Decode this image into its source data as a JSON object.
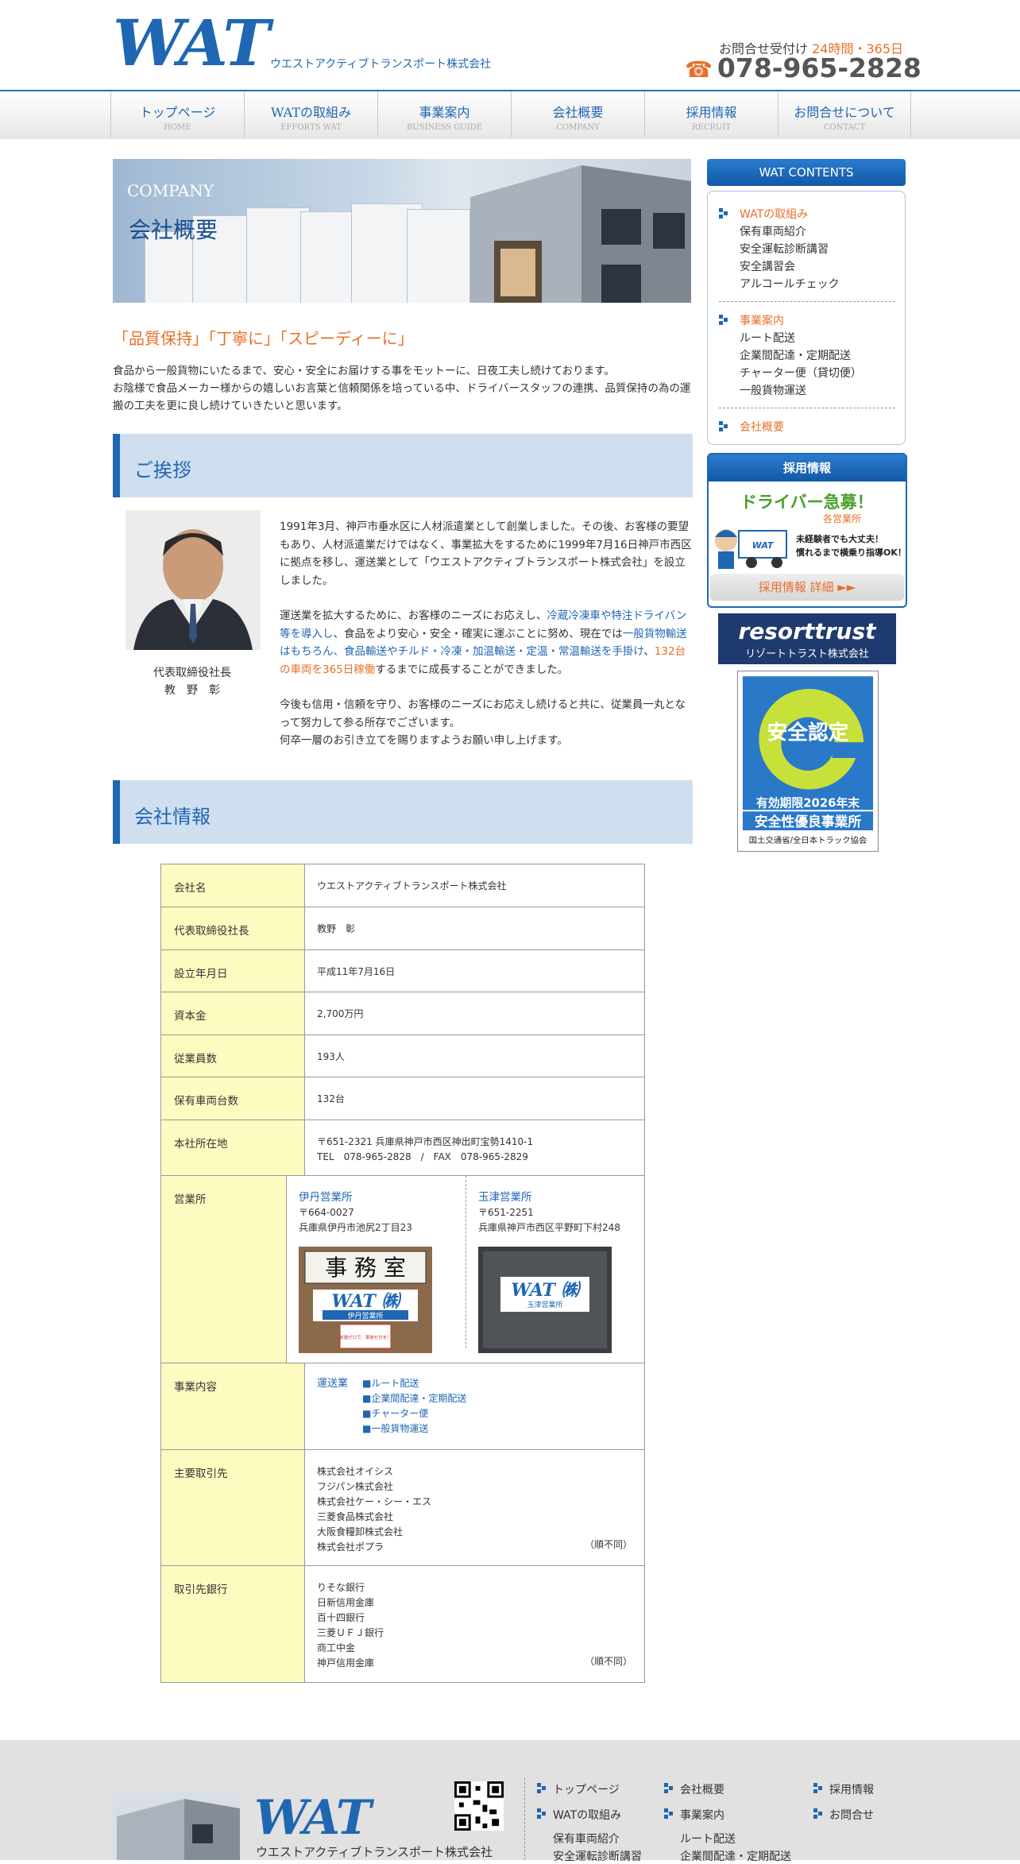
{
  "header": {
    "logo": "WAT",
    "company_name": "ウエストアクティブトランスポート株式会社",
    "contact_label": "お問合せ受付け",
    "contact_hours": "24時間・365日",
    "phone": "078-965-2828"
  },
  "nav": [
    {
      "label": "トップページ",
      "sub": "HOME"
    },
    {
      "label": "WATの取組み",
      "sub": "EFFORTS WAT"
    },
    {
      "label": "事業案内",
      "sub": "BUSINESS GUIDE"
    },
    {
      "label": "会社概要",
      "sub": "COMPANY"
    },
    {
      "label": "採用情報",
      "sub": "RECRUIT"
    },
    {
      "label": "お問合せについて",
      "sub": "CONTACT"
    }
  ],
  "hero": {
    "en": "COMPANY",
    "jp": "会社概要"
  },
  "catch": "「品質保持」「丁寧に」「スピーディーに」",
  "intro": {
    "line1": "食品から一般貨物にいたるまで、安心・安全にお届けする事をモットーに、日夜工夫し続けております。",
    "line2": "お陰様で食品メーカー様からの嬉しいお言葉と信頼関係を培っている中、ドライバースタッフの連携、品質保持の為の運搬の工夫を更に良し続けていきたいと思います。"
  },
  "greeting": {
    "heading": "ご挨拶",
    "president_title": "代表取締役社長",
    "president_name": "教　野　彰",
    "p1": "1991年3月、神戸市垂水区に人材派遣業として創業しました。その後、お客様の要望もあり、人材派遣業だけではなく、事業拡大をするために1999年7月16日神戸市西区に拠点を移し、運送業として「ウエストアクティブトランスポート株式会社」を設立しました。",
    "p2_a": "運送業を拡大するために、お客様のニーズにお応えし、",
    "p2_b": "冷蔵冷凍車や特注ドライバン等を導入し",
    "p2_c": "、食品をより安心・安全・確実に運ぶことに努め、現在では",
    "p2_d": "一般貨物輸送はもちろん、食品輸送やチルド・冷凍・加温輸送・定温・常温輸送を手掛け",
    "p2_e": "、",
    "p2_f": "132台の車両を365日稼働",
    "p2_g": "するまでに成長することができました。",
    "p3": "今後も信用・信頼を守り、お客様のニーズにお応えし続けると共に、従業員一丸となって努力して参る所存でございます。",
    "p4": "何卒一層のお引き立てを賜りますようお願い申し上げます。"
  },
  "info": {
    "heading": "会社情報",
    "rows": {
      "name": {
        "label": "会社名",
        "value": "ウエストアクティブトランスポート株式会社"
      },
      "ceo": {
        "label": "代表取締役社長",
        "value": "教野　彰"
      },
      "founded": {
        "label": "設立年月日",
        "value": "平成11年7月16日"
      },
      "capital": {
        "label": "資本金",
        "value": "2,700万円"
      },
      "employees": {
        "label": "従業員数",
        "value": "193人"
      },
      "vehicles": {
        "label": "保有車両台数",
        "value": "132台"
      },
      "hq": {
        "label": "本社所在地",
        "address": "〒651-2321 兵庫県神戸市西区神出町宝勢1410-1",
        "tel": "TEL　078-965-2828　/　FAX　078-965-2829"
      },
      "offices": {
        "label": "営業所",
        "itami": {
          "name": "伊丹営業所",
          "zip": "〒664-0027",
          "address": "兵庫県伊丹市池尻2丁目23",
          "sign_top": "事 務 室",
          "sign_wat": "WAT ㈱",
          "sign_branch": "伊丹営業所",
          "sticker": "前進ゼロで、事故ゼロを！"
        },
        "tamatsu": {
          "name": "玉津営業所",
          "zip": "〒651-2251",
          "address": "兵庫県神戸市西区平野町下村248",
          "sign_wat": "WAT ㈱",
          "sign_branch": "玉津営業所"
        }
      },
      "business": {
        "label": "事業内容",
        "category": "運送業",
        "items": [
          "■ルート配送",
          "■企業間配達・定期配送",
          "■チャーター便",
          "■一般貨物運送"
        ]
      },
      "clients": {
        "label": "主要取引先",
        "items": [
          "株式会社オイシス",
          "フジパン株式会社",
          "株式会社ケー・シー・エス",
          "三菱食品株式会社",
          "大阪食糧卸株式会社",
          "株式会社ポプラ"
        ],
        "order": "（順不同）"
      },
      "banks": {
        "label": "取引先銀行",
        "items": [
          "りそな銀行",
          "日新信用金庫",
          "百十四銀行",
          "三菱ＵＦＪ銀行",
          "商工中金",
          "神戸信用金庫"
        ],
        "order": "（順不同）"
      }
    }
  },
  "sidebar": {
    "contents_title": "WAT CONTENTS",
    "g1_head": "WATの取組み",
    "g1_items": [
      "保有車両紹介",
      "安全運転診断講習",
      "安全講習会",
      "アルコールチェック"
    ],
    "g2_head": "事業案内",
    "g2_items": [
      "ルート配送",
      "企業間配達・定期配送",
      "チャーター便（貸切便）",
      "一般貨物運送"
    ],
    "g3_head": "会社概要",
    "recruit": {
      "title": "採用情報",
      "main": "ドライバー急募！",
      "sub": "各営業所",
      "note1": "未経験者でも大丈夫！",
      "note2": "慣れるまで横乗り指導OK！",
      "mascot": "WAT",
      "button": "採用情報 詳細 ►►"
    },
    "resort": {
      "t1": "resorttrust",
      "t2": "リゾートトラスト株式会社"
    },
    "safety": {
      "title": "安全認定",
      "validity": "有効期限2026年末",
      "grade": "安全性優良事業所",
      "issuer": "国土交通省/全日本トラック協会"
    }
  },
  "footer": {
    "logo": "WAT",
    "company": "ウエストアクティブトランスポート株式会社",
    "links": [
      "トップページ",
      "会社概要",
      "採用情報",
      "WATの取組み",
      "事業案内",
      "お問合せ"
    ],
    "subs": [
      "保有車両紹介",
      "安全運転診断講習",
      "ルート配送",
      "企業間配達・定期配送"
    ]
  },
  "colors": {
    "brand_blue": "#1f66b3",
    "accent_orange": "#e8702a",
    "table_head": "#fdfcc0",
    "section_bg": "#cfdff0"
  }
}
